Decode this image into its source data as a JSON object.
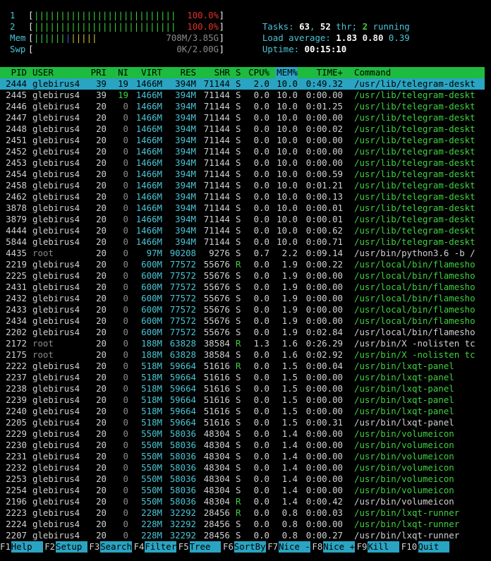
{
  "meters": {
    "cpu1": {
      "label": "1",
      "value": "100.0%",
      "fill": 1.0
    },
    "cpu2": {
      "label": "2",
      "value": "100.0%",
      "fill": 1.0
    },
    "mem": {
      "label": "Mem",
      "value": "708M/3.85G"
    },
    "swp": {
      "label": "Swp",
      "value": "0K/2.00G"
    }
  },
  "summary": {
    "tasks_label": "Tasks: ",
    "tasks": "63",
    "sep1": ", ",
    "threads": "52",
    "thr_label": " thr; ",
    "running": "2",
    "running_label": " running",
    "load_label": "Load average: ",
    "load1": "1.83",
    "load5": "0.80",
    "load15": "0.39",
    "uptime_label": "Uptime: ",
    "uptime": "00:15:10"
  },
  "columns": {
    "pid": "PID",
    "user": "USER",
    "pri": "PRI",
    "ni": "NI",
    "virt": "VIRT",
    "res": "RES",
    "shr": "SHR",
    "s": "S",
    "cpu": "CPU%",
    "mem": "MEM%",
    "time": "TIME+",
    "command": "Command"
  },
  "processes": [
    {
      "pid": "2444",
      "user": "glebirus4",
      "pri": "39",
      "ni": "19",
      "virt": "1466M",
      "res": "394M",
      "shr": "71144",
      "s": "S",
      "cpu": "2.0",
      "mem": "10.0",
      "time": "0:49.32",
      "command": "/usr/lib/telegram-deskt"
    },
    {
      "pid": "2445",
      "user": "glebirus4",
      "pri": "39",
      "ni": "19",
      "virt": "1466M",
      "res": "394M",
      "shr": "71144",
      "s": "S",
      "cpu": "0.0",
      "mem": "10.0",
      "time": "0:00.00",
      "command": "/usr/lib/telegram-deskt"
    },
    {
      "pid": "2446",
      "user": "glebirus4",
      "pri": "20",
      "ni": "0",
      "virt": "1466M",
      "res": "394M",
      "shr": "71144",
      "s": "S",
      "cpu": "0.0",
      "mem": "10.0",
      "time": "0:01.25",
      "command": "/usr/lib/telegram-deskt"
    },
    {
      "pid": "2447",
      "user": "glebirus4",
      "pri": "20",
      "ni": "0",
      "virt": "1466M",
      "res": "394M",
      "shr": "71144",
      "s": "S",
      "cpu": "0.0",
      "mem": "10.0",
      "time": "0:00.00",
      "command": "/usr/lib/telegram-deskt"
    },
    {
      "pid": "2448",
      "user": "glebirus4",
      "pri": "20",
      "ni": "0",
      "virt": "1466M",
      "res": "394M",
      "shr": "71144",
      "s": "S",
      "cpu": "0.0",
      "mem": "10.0",
      "time": "0:00.02",
      "command": "/usr/lib/telegram-deskt"
    },
    {
      "pid": "2451",
      "user": "glebirus4",
      "pri": "20",
      "ni": "0",
      "virt": "1466M",
      "res": "394M",
      "shr": "71144",
      "s": "S",
      "cpu": "0.0",
      "mem": "10.0",
      "time": "0:00.00",
      "command": "/usr/lib/telegram-deskt"
    },
    {
      "pid": "2452",
      "user": "glebirus4",
      "pri": "20",
      "ni": "0",
      "virt": "1466M",
      "res": "394M",
      "shr": "71144",
      "s": "S",
      "cpu": "0.0",
      "mem": "10.0",
      "time": "0:00.00",
      "command": "/usr/lib/telegram-deskt"
    },
    {
      "pid": "2453",
      "user": "glebirus4",
      "pri": "20",
      "ni": "0",
      "virt": "1466M",
      "res": "394M",
      "shr": "71144",
      "s": "S",
      "cpu": "0.0",
      "mem": "10.0",
      "time": "0:00.00",
      "command": "/usr/lib/telegram-deskt"
    },
    {
      "pid": "2454",
      "user": "glebirus4",
      "pri": "20",
      "ni": "0",
      "virt": "1466M",
      "res": "394M",
      "shr": "71144",
      "s": "S",
      "cpu": "0.0",
      "mem": "10.0",
      "time": "0:00.59",
      "command": "/usr/lib/telegram-deskt"
    },
    {
      "pid": "2458",
      "user": "glebirus4",
      "pri": "20",
      "ni": "0",
      "virt": "1466M",
      "res": "394M",
      "shr": "71144",
      "s": "S",
      "cpu": "0.0",
      "mem": "10.0",
      "time": "0:01.21",
      "command": "/usr/lib/telegram-deskt"
    },
    {
      "pid": "2462",
      "user": "glebirus4",
      "pri": "20",
      "ni": "0",
      "virt": "1466M",
      "res": "394M",
      "shr": "71144",
      "s": "S",
      "cpu": "0.0",
      "mem": "10.0",
      "time": "0:00.13",
      "command": "/usr/lib/telegram-deskt"
    },
    {
      "pid": "3878",
      "user": "glebirus4",
      "pri": "20",
      "ni": "0",
      "virt": "1466M",
      "res": "394M",
      "shr": "71144",
      "s": "S",
      "cpu": "0.0",
      "mem": "10.0",
      "time": "0:00.01",
      "command": "/usr/lib/telegram-deskt"
    },
    {
      "pid": "3879",
      "user": "glebirus4",
      "pri": "20",
      "ni": "0",
      "virt": "1466M",
      "res": "394M",
      "shr": "71144",
      "s": "S",
      "cpu": "0.0",
      "mem": "10.0",
      "time": "0:00.01",
      "command": "/usr/lib/telegram-deskt"
    },
    {
      "pid": "4444",
      "user": "glebirus4",
      "pri": "20",
      "ni": "0",
      "virt": "1466M",
      "res": "394M",
      "shr": "71144",
      "s": "S",
      "cpu": "0.0",
      "mem": "10.0",
      "time": "0:00.62",
      "command": "/usr/lib/telegram-deskt"
    },
    {
      "pid": "5844",
      "user": "glebirus4",
      "pri": "20",
      "ni": "0",
      "virt": "1466M",
      "res": "394M",
      "shr": "71144",
      "s": "S",
      "cpu": "0.0",
      "mem": "10.0",
      "time": "0:00.71",
      "command": "/usr/lib/telegram-deskt"
    },
    {
      "pid": "4435",
      "user": "root",
      "pri": "20",
      "ni": "0",
      "virt": "97M",
      "res": "90208",
      "shr": "9276",
      "s": "S",
      "cpu": "0.7",
      "mem": "2.2",
      "time": "0:09.14",
      "command": "/usr/bin/python3.6 -b /"
    },
    {
      "pid": "2219",
      "user": "glebirus4",
      "pri": "20",
      "ni": "0",
      "virt": "600M",
      "res": "77572",
      "shr": "55676",
      "s": "R",
      "cpu": "0.0",
      "mem": "1.9",
      "time": "0:00.22",
      "command": "/usr/local/bin/flamesho"
    },
    {
      "pid": "2225",
      "user": "glebirus4",
      "pri": "20",
      "ni": "0",
      "virt": "600M",
      "res": "77572",
      "shr": "55676",
      "s": "S",
      "cpu": "0.0",
      "mem": "1.9",
      "time": "0:00.00",
      "command": "/usr/local/bin/flamesho"
    },
    {
      "pid": "2431",
      "user": "glebirus4",
      "pri": "20",
      "ni": "0",
      "virt": "600M",
      "res": "77572",
      "shr": "55676",
      "s": "S",
      "cpu": "0.0",
      "mem": "1.9",
      "time": "0:00.00",
      "command": "/usr/local/bin/flamesho"
    },
    {
      "pid": "2432",
      "user": "glebirus4",
      "pri": "20",
      "ni": "0",
      "virt": "600M",
      "res": "77572",
      "shr": "55676",
      "s": "S",
      "cpu": "0.0",
      "mem": "1.9",
      "time": "0:00.00",
      "command": "/usr/local/bin/flamesho"
    },
    {
      "pid": "2433",
      "user": "glebirus4",
      "pri": "20",
      "ni": "0",
      "virt": "600M",
      "res": "77572",
      "shr": "55676",
      "s": "S",
      "cpu": "0.0",
      "mem": "1.9",
      "time": "0:00.00",
      "command": "/usr/local/bin/flamesho"
    },
    {
      "pid": "2434",
      "user": "glebirus4",
      "pri": "20",
      "ni": "0",
      "virt": "600M",
      "res": "77572",
      "shr": "55676",
      "s": "S",
      "cpu": "0.0",
      "mem": "1.9",
      "time": "0:00.00",
      "command": "/usr/local/bin/flamesho"
    },
    {
      "pid": "2202",
      "user": "glebirus4",
      "pri": "20",
      "ni": "0",
      "virt": "600M",
      "res": "77572",
      "shr": "55676",
      "s": "S",
      "cpu": "0.0",
      "mem": "1.9",
      "time": "0:02.84",
      "command": "/usr/local/bin/flamesho"
    },
    {
      "pid": "2172",
      "user": "root",
      "pri": "20",
      "ni": "0",
      "virt": "188M",
      "res": "63828",
      "shr": "38584",
      "s": "R",
      "cpu": "1.3",
      "mem": "1.6",
      "time": "0:26.29",
      "command": "/usr/bin/X -nolisten tc"
    },
    {
      "pid": "2175",
      "user": "root",
      "pri": "20",
      "ni": "0",
      "virt": "188M",
      "res": "63828",
      "shr": "38584",
      "s": "S",
      "cpu": "0.0",
      "mem": "1.6",
      "time": "0:02.92",
      "command": "/usr/bin/X -nolisten tc"
    },
    {
      "pid": "2222",
      "user": "glebirus4",
      "pri": "20",
      "ni": "0",
      "virt": "518M",
      "res": "59664",
      "shr": "51616",
      "s": "R",
      "cpu": "0.0",
      "mem": "1.5",
      "time": "0:00.04",
      "command": "/usr/bin/lxqt-panel"
    },
    {
      "pid": "2237",
      "user": "glebirus4",
      "pri": "20",
      "ni": "0",
      "virt": "518M",
      "res": "59664",
      "shr": "51616",
      "s": "S",
      "cpu": "0.0",
      "mem": "1.5",
      "time": "0:00.00",
      "command": "/usr/bin/lxqt-panel"
    },
    {
      "pid": "2238",
      "user": "glebirus4",
      "pri": "20",
      "ni": "0",
      "virt": "518M",
      "res": "59664",
      "shr": "51616",
      "s": "S",
      "cpu": "0.0",
      "mem": "1.5",
      "time": "0:00.00",
      "command": "/usr/bin/lxqt-panel"
    },
    {
      "pid": "2239",
      "user": "glebirus4",
      "pri": "20",
      "ni": "0",
      "virt": "518M",
      "res": "59664",
      "shr": "51616",
      "s": "S",
      "cpu": "0.0",
      "mem": "1.5",
      "time": "0:00.00",
      "command": "/usr/bin/lxqt-panel"
    },
    {
      "pid": "2240",
      "user": "glebirus4",
      "pri": "20",
      "ni": "0",
      "virt": "518M",
      "res": "59664",
      "shr": "51616",
      "s": "S",
      "cpu": "0.0",
      "mem": "1.5",
      "time": "0:00.00",
      "command": "/usr/bin/lxqt-panel"
    },
    {
      "pid": "2205",
      "user": "glebirus4",
      "pri": "20",
      "ni": "0",
      "virt": "518M",
      "res": "59664",
      "shr": "51616",
      "s": "S",
      "cpu": "0.0",
      "mem": "1.5",
      "time": "0:00.31",
      "command": "/usr/bin/lxqt-panel"
    },
    {
      "pid": "2229",
      "user": "glebirus4",
      "pri": "20",
      "ni": "0",
      "virt": "550M",
      "res": "58036",
      "shr": "48304",
      "s": "S",
      "cpu": "0.0",
      "mem": "1.4",
      "time": "0:00.00",
      "command": "/usr/bin/volumeicon"
    },
    {
      "pid": "2230",
      "user": "glebirus4",
      "pri": "20",
      "ni": "0",
      "virt": "550M",
      "res": "58036",
      "shr": "48304",
      "s": "S",
      "cpu": "0.0",
      "mem": "1.4",
      "time": "0:00.00",
      "command": "/usr/bin/volumeicon"
    },
    {
      "pid": "2231",
      "user": "glebirus4",
      "pri": "20",
      "ni": "0",
      "virt": "550M",
      "res": "58036",
      "shr": "48304",
      "s": "S",
      "cpu": "0.0",
      "mem": "1.4",
      "time": "0:00.00",
      "command": "/usr/bin/volumeicon"
    },
    {
      "pid": "2232",
      "user": "glebirus4",
      "pri": "20",
      "ni": "0",
      "virt": "550M",
      "res": "58036",
      "shr": "48304",
      "s": "S",
      "cpu": "0.0",
      "mem": "1.4",
      "time": "0:00.00",
      "command": "/usr/bin/volumeicon"
    },
    {
      "pid": "2253",
      "user": "glebirus4",
      "pri": "20",
      "ni": "0",
      "virt": "550M",
      "res": "58036",
      "shr": "48304",
      "s": "S",
      "cpu": "0.0",
      "mem": "1.4",
      "time": "0:00.00",
      "command": "/usr/bin/volumeicon"
    },
    {
      "pid": "2254",
      "user": "glebirus4",
      "pri": "20",
      "ni": "0",
      "virt": "550M",
      "res": "58036",
      "shr": "48304",
      "s": "S",
      "cpu": "0.0",
      "mem": "1.4",
      "time": "0:00.00",
      "command": "/usr/bin/volumeicon"
    },
    {
      "pid": "2196",
      "user": "glebirus4",
      "pri": "20",
      "ni": "0",
      "virt": "550M",
      "res": "58036",
      "shr": "48304",
      "s": "R",
      "cpu": "0.0",
      "mem": "1.4",
      "time": "0:00.42",
      "command": "/usr/bin/volumeicon"
    },
    {
      "pid": "2223",
      "user": "glebirus4",
      "pri": "20",
      "ni": "0",
      "virt": "228M",
      "res": "32292",
      "shr": "28456",
      "s": "R",
      "cpu": "0.0",
      "mem": "0.8",
      "time": "0:00.03",
      "command": "/usr/bin/lxqt-runner"
    },
    {
      "pid": "2224",
      "user": "glebirus4",
      "pri": "20",
      "ni": "0",
      "virt": "228M",
      "res": "32292",
      "shr": "28456",
      "s": "S",
      "cpu": "0.0",
      "mem": "0.8",
      "time": "0:00.00",
      "command": "/usr/bin/lxqt-runner"
    },
    {
      "pid": "2207",
      "user": "glebirus4",
      "pri": "20",
      "ni": "0",
      "virt": "228M",
      "res": "32292",
      "shr": "28456",
      "s": "S",
      "cpu": "0.0",
      "mem": "0.8",
      "time": "0:00.27",
      "command": "/usr/bin/lxqt-runner"
    }
  ],
  "fkeys": [
    {
      "key": "F1",
      "label": "Help  "
    },
    {
      "key": "F2",
      "label": "Setup "
    },
    {
      "key": "F3",
      "label": "Search"
    },
    {
      "key": "F4",
      "label": "Filter"
    },
    {
      "key": "F5",
      "label": "Tree  "
    },
    {
      "key": "F6",
      "label": "SortBy"
    },
    {
      "key": "F7",
      "label": "Nice -"
    },
    {
      "key": "F8",
      "label": "Nice +"
    },
    {
      "key": "F9",
      "label": "Kill  "
    },
    {
      "key": "F10",
      "label": "Quit  "
    }
  ],
  "colors": {
    "header_bg": "#1dbb3f",
    "selection_bg": "#2aa4c2",
    "thread_cmd": "#3fd13f",
    "cyan": "#49c5d6"
  }
}
